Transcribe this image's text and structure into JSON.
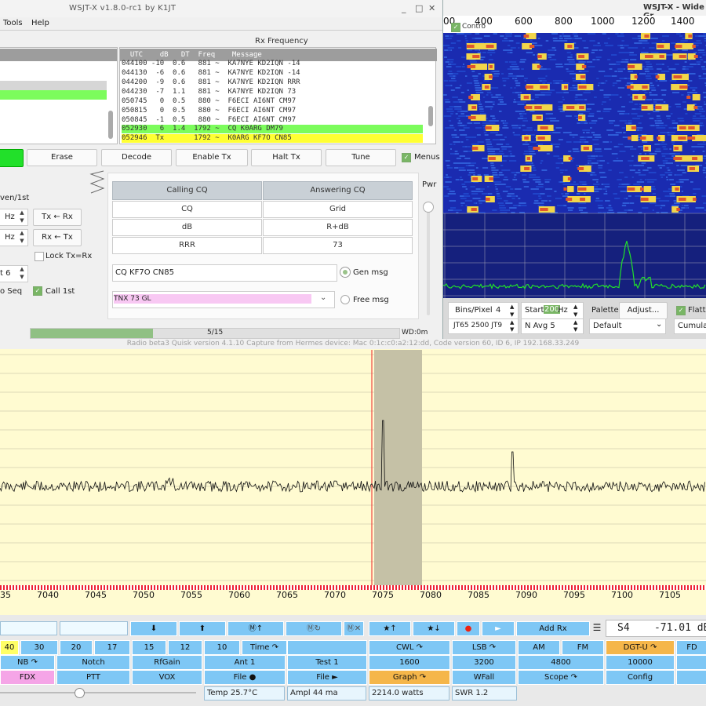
{
  "wsjtx": {
    "title": "WSJT-X   v1.8.0-rc1   by K1JT",
    "window_controls": [
      "_",
      "□",
      "✕"
    ],
    "menus": [
      "Tools",
      "Help"
    ],
    "rx_frequency_label": "Rx Frequency",
    "rx_header": "  UTC    dB   DT  Freq    Message",
    "rx_lines": [
      "044100 -10  0.6   881 ~  KA7NYE KD2IQN -14",
      "044130  -6  0.6   881 ~  KA7NYE KD2IQN -14",
      "044200  -9  0.6   881 ~  KA7NYE KD2IQN RRR",
      "044230  -7  1.1   881 ~  KA7NYE KD2IQN 73",
      "050745   0  0.5   880 ~  F6ECI AI6NT CM97",
      "050815   0  0.5   880 ~  F6ECI AI6NT CM97",
      "050845  -1  0.5   880 ~  F6ECI AI6NT CM97",
      "052930   6  1.4  1792 ~  CQ K0ARG DM79",
      "052946  Tx       1792 ~  K0ARG KF7O CN85"
    ],
    "rx_highlight_colors": {
      "cq": "#7cfc5c",
      "tx": "#ffff33"
    },
    "buttons": {
      "erase": "Erase",
      "decode": "Decode",
      "enable_tx": "Enable Tx",
      "halt_tx": "Halt Tx",
      "tune": "Tune",
      "menus": "Menus"
    },
    "left_panel": {
      "even_first": "ven/1st",
      "hz1": "Hz",
      "hz2": "Hz",
      "tx_rx1": "Tx ← Rx",
      "rx_tx": "Rx ← Tx",
      "lock": "Lock Tx=Rx",
      "spin_value": "t 6",
      "auto_seq": "o Seq",
      "call_first": "Call 1st"
    },
    "macros": {
      "calling_cq": "Calling CQ",
      "answering_cq": "Answering CQ",
      "left": [
        "CQ",
        "dB",
        "RRR"
      ],
      "right": [
        "Grid",
        "R+dB",
        "73"
      ],
      "gen_input": "CQ KF7O CN85",
      "gen_label": "Gen msg",
      "free_input": "TNX 73 GL",
      "free_label": "Free msg",
      "pwr": "Pwr"
    },
    "status": {
      "progress": "5/15",
      "wd": "WD:0m"
    }
  },
  "wide": {
    "title": "WSJT-X - Wide Gr",
    "controls_label": "Contro",
    "freq_ticks": [
      "00",
      "400",
      "600",
      "800",
      "1000",
      "1200",
      "1400"
    ],
    "bins_label": "Bins/Pixel",
    "bins_value": "4",
    "start_label": "Start",
    "start_value": "200",
    "start_unit": "Hz",
    "palette": "Palette",
    "adjust": "Adjust...",
    "flatten": "Flatte",
    "mode": "JT65  2500  JT9",
    "navg": "N Avg 5",
    "default": "Default",
    "cumulative": "Cumulati"
  },
  "quisk": {
    "title": "Radio beta3   Quisk version 4.1.10   Capture from Hermes device: Mac  0:1c:c0:a2:12:dd, Code version 60, ID 6, IP 192.168.33.249",
    "x_labels": [
      "35",
      "7040",
      "7045",
      "7050",
      "7055",
      "7060",
      "7065",
      "7070",
      "7075",
      "7080",
      "7085",
      "7090",
      "7095",
      "7100",
      "7105"
    ],
    "row1": [
      "⬇",
      "⬆",
      "Ⓜ↑",
      "Ⓜ↻",
      "Ⓜ✕",
      "★↑",
      "★↓",
      "●",
      "►",
      "Add Rx"
    ],
    "smeter": "S4    -71.01 dB",
    "row2_bands": [
      "40",
      "30",
      "20",
      "17",
      "15",
      "12",
      "10",
      "Time ↷",
      "",
      "CWL ↷",
      "LSB ↷",
      "AM",
      "FM",
      "DGT-U ↷",
      "FD"
    ],
    "row3": [
      "NB ↷",
      "Notch",
      "RfGain",
      "Ant 1",
      "Test 1",
      "1600",
      "3200",
      "4800",
      "10000",
      ""
    ],
    "row4": [
      "FDX",
      "PTT",
      "VOX",
      "File ●",
      "File ►",
      "Graph ↷",
      "WFall",
      "Scope ↷",
      "Config",
      ""
    ],
    "status": {
      "temp": "Temp 25.7°C",
      "ampl": "Ampl  44 ma",
      "watts": "2214.0 watts",
      "swr": "SWR 1.2"
    }
  }
}
